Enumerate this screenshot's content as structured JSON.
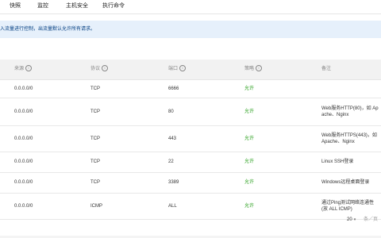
{
  "tabs": [
    {
      "label": "快照"
    },
    {
      "label": "监控"
    },
    {
      "label": "主机安全"
    },
    {
      "label": "执行命令"
    }
  ],
  "banner": {
    "text": "入流量进行控制，出流量默认允许所有请求。"
  },
  "table": {
    "headers": {
      "source": "来源",
      "protocol": "协议",
      "port": "端口",
      "policy": "策略",
      "note": "备注"
    },
    "rows": [
      {
        "source": "0.0.0.0/0",
        "protocol": "TCP",
        "port": "6666",
        "policy": "允许",
        "note": ""
      },
      {
        "source": "0.0.0.0/0",
        "protocol": "TCP",
        "port": "80",
        "policy": "允许",
        "note": "Web服务HTTP(80)，如 Apache、Nginx"
      },
      {
        "source": "0.0.0.0/0",
        "protocol": "TCP",
        "port": "443",
        "policy": "允许",
        "note": "Web服务HTTPS(443)，如 Apache、Nginx"
      },
      {
        "source": "0.0.0.0/0",
        "protocol": "TCP",
        "port": "22",
        "policy": "允许",
        "note": "Linux SSH登录"
      },
      {
        "source": "0.0.0.0/0",
        "protocol": "TCP",
        "port": "3389",
        "policy": "允许",
        "note": "Windows远程桌面登录"
      },
      {
        "source": "0.0.0.0/0",
        "protocol": "ICMP",
        "port": "ALL",
        "policy": "允许",
        "note": "通过Ping测试网络连通性(放 ALL ICMP)"
      }
    ]
  },
  "pagination": {
    "page_size": "20",
    "per_page_label": "条／页"
  },
  "colors": {
    "allow": "#2ea121",
    "banner_bg": "#e6f0fb",
    "header_bg": "#f2f2f2"
  }
}
